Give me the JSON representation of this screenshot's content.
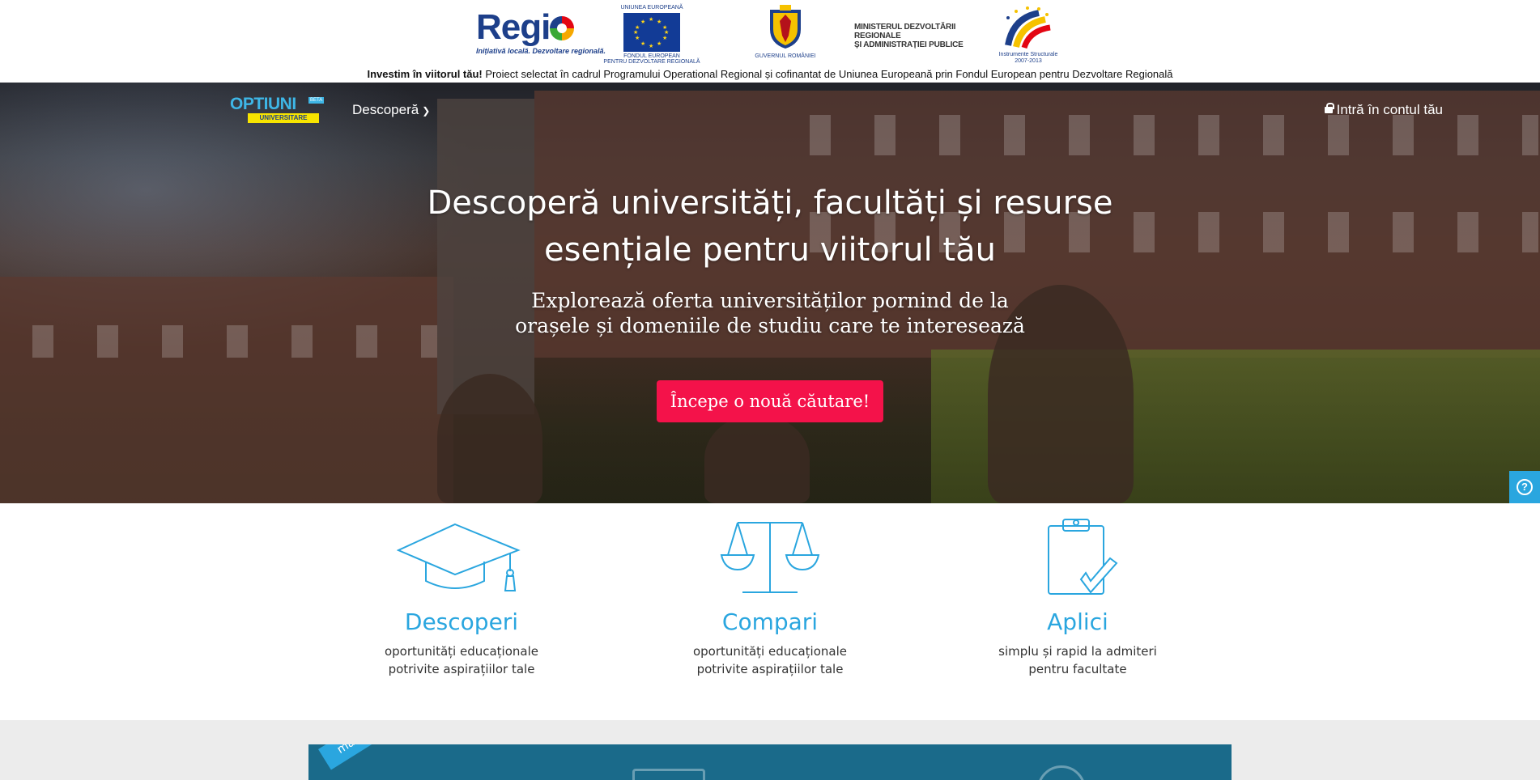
{
  "banner": {
    "regio": {
      "word_before": "Regi",
      "subtitle": "Inițiativă locală. Dezvoltare regională."
    },
    "eu": {
      "top_caption": "UNIUNEA EUROPEANĂ",
      "bottom_caption_1": "FONDUL EUROPEAN",
      "bottom_caption_2": "PENTRU DEZVOLTARE REGIONALĂ"
    },
    "gov": {
      "caption": "GUVERNUL ROMÂNIEI"
    },
    "mdr": {
      "line1": "MINISTERUL DEZVOLTĂRII REGIONALE",
      "line2": "ȘI ADMINISTRAȚIEI PUBLICE"
    },
    "is": {
      "caption1": "Instrumente Structurale",
      "caption2": "2007-2013"
    },
    "note_bold": "Investim în viitorul tău!",
    "note_text": " Proiect selectat în cadrul Programului Operational Regional și cofinantat de Uniunea Europeană prin Fondul European pentru Dezvoltare Regională"
  },
  "nav": {
    "logo_word": "OPTIUNI",
    "logo_badge": "BETA",
    "logo_sub": "UNIVERSITARE",
    "discover_label": "Descoperă",
    "login_label": "Intră în contul tău"
  },
  "hero": {
    "title_line1": "Descoperă universități, facultăți și resurse",
    "title_line2": "esențiale pentru viitorul tău",
    "subtitle": "Explorează oferta universităților pornind de la orașele și domeniile de studiu care te interesează",
    "cta_label": "Începe o nouă căutare!",
    "help_label": "?"
  },
  "features": [
    {
      "title": "Descoperi",
      "desc": "oportunități educaționale potrivite aspirațiilor tale"
    },
    {
      "title": "Compari",
      "desc": "oportunități educaționale potrivite aspirațiilor tale"
    },
    {
      "title": "Aplici",
      "desc": "simplu și rapid la admiteri pentru facultate"
    }
  ],
  "promo": {
    "ribbon_label": "mandare"
  },
  "colors": {
    "accent": "#2aa6df",
    "cta": "#f4124a",
    "promo_bg": "#1a6a8a"
  }
}
